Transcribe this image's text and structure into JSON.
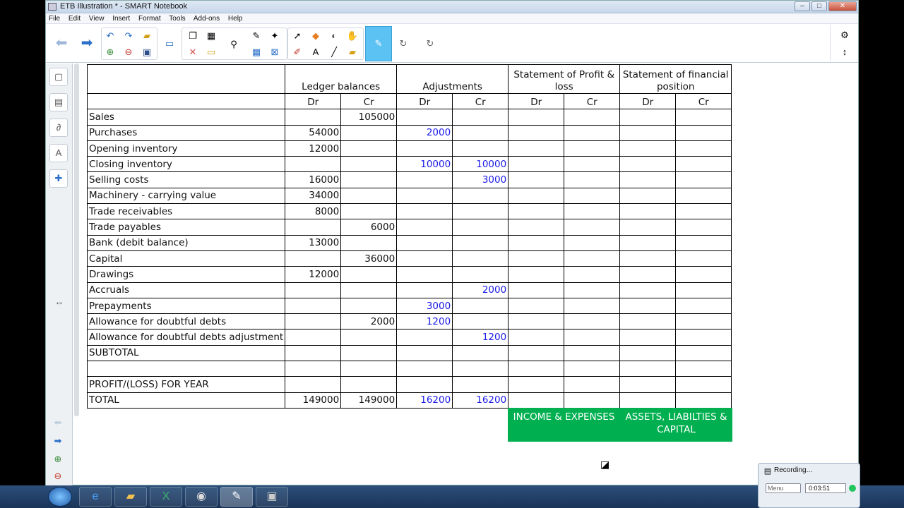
{
  "window": {
    "title": "ETB Illustration * - SMART Notebook",
    "controls": {
      "minimize": "–",
      "maximize": "□",
      "close": "✕"
    }
  },
  "menu": [
    "File",
    "Edit",
    "View",
    "Insert",
    "Format",
    "Tools",
    "Add-ons",
    "Help"
  ],
  "table": {
    "headers_top": {
      "ledger": "Ledger balances",
      "adjustments": "Adjustments",
      "pl": "Statement of Profit & loss",
      "sfp": "Statement of financial position"
    },
    "headers_sub": [
      "Dr",
      "Cr",
      "Dr",
      "Cr",
      "Dr",
      "Cr",
      "Dr",
      "Cr"
    ],
    "rows": [
      {
        "label": "Sales",
        "ldr": "",
        "lcr": "105000",
        "adr": "",
        "acr": ""
      },
      {
        "label": "Purchases",
        "ldr": "54000",
        "lcr": "",
        "adr": "2000",
        "acr": ""
      },
      {
        "label": "Opening inventory",
        "ldr": "12000",
        "lcr": "",
        "adr": "",
        "acr": ""
      },
      {
        "label": "Closing inventory",
        "ldr": "",
        "lcr": "",
        "adr": "10000",
        "acr": "10000"
      },
      {
        "label": "Selling costs",
        "ldr": "16000",
        "lcr": "",
        "adr": "",
        "acr": "3000"
      },
      {
        "label": "Machinery - carrying value",
        "ldr": "34000",
        "lcr": "",
        "adr": "",
        "acr": ""
      },
      {
        "label": "Trade receivables",
        "ldr": "8000",
        "lcr": "",
        "adr": "",
        "acr": ""
      },
      {
        "label": "Trade payables",
        "ldr": "",
        "lcr": "6000",
        "adr": "",
        "acr": ""
      },
      {
        "label": "Bank (debit balance)",
        "ldr": "13000",
        "lcr": "",
        "adr": "",
        "acr": ""
      },
      {
        "label": "Capital",
        "ldr": "",
        "lcr": "36000",
        "adr": "",
        "acr": ""
      },
      {
        "label": "Drawings",
        "ldr": "12000",
        "lcr": "",
        "adr": "",
        "acr": ""
      },
      {
        "label": "Accruals",
        "ldr": "",
        "lcr": "",
        "adr": "",
        "acr": "2000"
      },
      {
        "label": "Prepayments",
        "ldr": "",
        "lcr": "",
        "adr": "3000",
        "acr": ""
      },
      {
        "label": "Allowance for doubtful debts",
        "ldr": "",
        "lcr": "2000",
        "adr": "1200",
        "acr": ""
      },
      {
        "label": "Allowance for doubtful debts adjustment",
        "ldr": "",
        "lcr": "",
        "adr": "",
        "acr": "1200"
      },
      {
        "label": "SUBTOTAL",
        "ldr": "",
        "lcr": "",
        "adr": "",
        "acr": ""
      },
      {
        "label": "",
        "ldr": "",
        "lcr": "",
        "adr": "",
        "acr": ""
      },
      {
        "label": "PROFIT/(LOSS) FOR YEAR",
        "ldr": "",
        "lcr": "",
        "adr": "",
        "acr": ""
      },
      {
        "label": "TOTAL",
        "ldr": "149000",
        "lcr": "149000",
        "adr": "16200",
        "acr": "16200"
      }
    ]
  },
  "boxes": {
    "income": "INCOME & EXPENSES",
    "assets": "ASSETS, LIABILTIES & CAPITAL"
  },
  "recorder": {
    "title": "Recording...",
    "menu": "Menu",
    "time": "0:03:51"
  },
  "colors": {
    "adjustment_text": "#1a1ae8",
    "green_box": "#00b050",
    "toolbar_selected": "#5cc1f3"
  }
}
